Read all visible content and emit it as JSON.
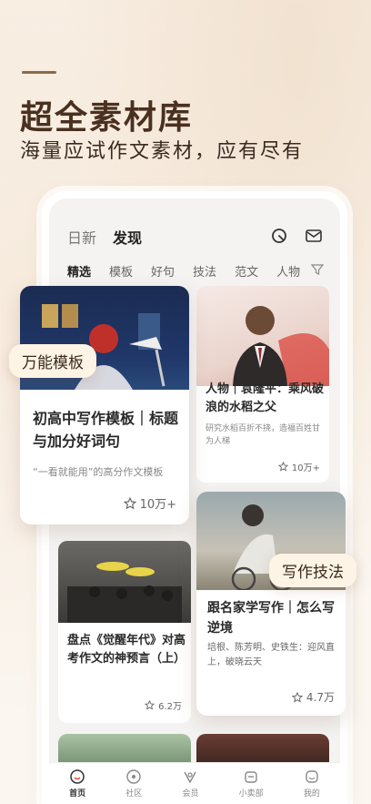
{
  "hero": {
    "headline": "超全素材库",
    "subheadline": "海量应试作文素材，应有尽有"
  },
  "app": {
    "top_tabs": [
      "日新",
      "发现"
    ],
    "active_top_tab": "发现",
    "icons": {
      "search": "search-icon",
      "mail": "mail-icon",
      "filter": "filter-icon"
    },
    "category_tabs": [
      "精选",
      "模板",
      "好句",
      "技法",
      "范文",
      "人物"
    ]
  },
  "cards": {
    "template": {
      "badge": "万能模板",
      "title": "初高中写作模板｜标题与加分好词句",
      "desc": "“一看就能用”的高分作文模板",
      "likes": "10万+"
    },
    "person": {
      "title": "人物｜袁隆平：乘风破浪的水稻之父",
      "desc": "研究水稻百折不挠，造福百姓甘为人梯",
      "likes": "10万+"
    },
    "awaken": {
      "title": "盘点《觉醒年代》对高考作文的神预言（上）",
      "likes": "6.2万"
    },
    "technique": {
      "badge": "写作技法",
      "title": "跟名家学写作｜怎么写逆境",
      "desc": "培根、陈芳明、史铁生：迎风直上，破晓云天",
      "likes": "4.7万"
    }
  },
  "bottom_nav": [
    {
      "label": "首页",
      "icon": "home-icon",
      "active": true
    },
    {
      "label": "社区",
      "icon": "community-icon",
      "active": false
    },
    {
      "label": "会员",
      "icon": "vip-icon",
      "active": false
    },
    {
      "label": "小卖部",
      "icon": "shop-icon",
      "active": false
    },
    {
      "label": "我的",
      "icon": "profile-icon",
      "active": false
    }
  ],
  "colors": {
    "brand": "#4a3020",
    "badge_bg": "#fdf4e6",
    "page_bg": "#fbf5ee"
  }
}
